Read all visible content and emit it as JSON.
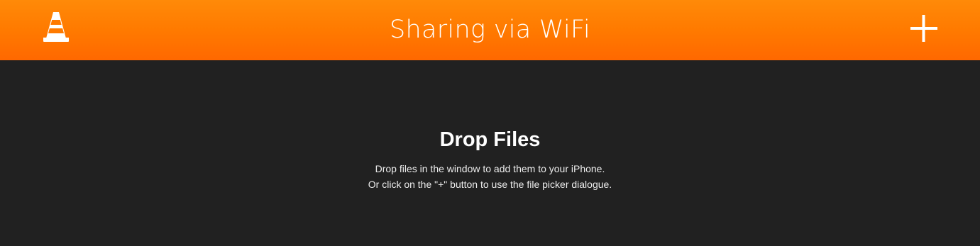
{
  "header": {
    "title": "Sharing via WiFi",
    "logo_icon": "vlc-cone-icon",
    "add_icon": "plus-icon",
    "background_color": "#ff7a00"
  },
  "main": {
    "heading": "Drop Files",
    "instructions": [
      "Drop files in the window to add them to your iPhone.",
      "Or click on the \"+\" button to use the file picker dialogue."
    ],
    "background_color": "#212121"
  }
}
